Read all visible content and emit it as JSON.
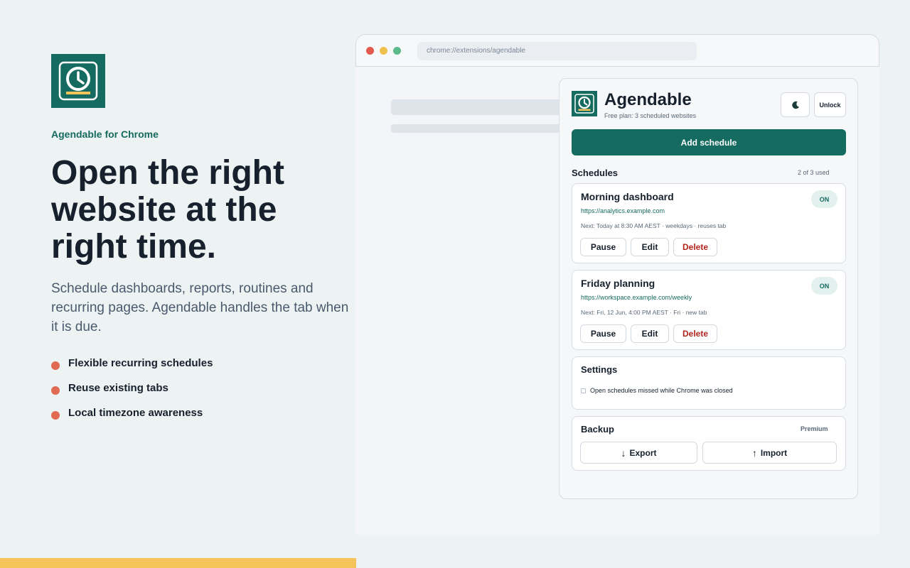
{
  "marketing": {
    "brand": "Agendable for Chrome",
    "headline": "Open the right website at the right time.",
    "subtext": "Schedule dashboards, reports, routines and recurring pages. Agendable handles the tab when it is due.",
    "features": [
      "Flexible recurring schedules",
      "Reuse existing tabs",
      "Local timezone awareness"
    ]
  },
  "browser": {
    "url": "chrome://extensions/agendable"
  },
  "popup": {
    "title": "Agendable",
    "plan": "Free plan: 3 scheduled websites",
    "theme_icon": "moon-icon",
    "unlock_label": "Unlock",
    "add_label": "Add schedule",
    "schedules_title": "Schedules",
    "schedules_used": "2 of 3 used",
    "schedules": [
      {
        "name": "Morning dashboard",
        "url": "https://analytics.example.com",
        "next": "Next: Today at 8:30 AM AEST · weekdays · reuses tab",
        "status": "ON",
        "pause": "Pause",
        "edit": "Edit",
        "delete": "Delete"
      },
      {
        "name": "Friday planning",
        "url": "https://workspace.example.com/weekly",
        "next": "Next: Fri, 12 Jun, 4:00 PM AEST · Fri · new tab",
        "status": "ON",
        "pause": "Pause",
        "edit": "Edit",
        "delete": "Delete"
      }
    ],
    "settings": {
      "title": "Settings",
      "option": "Open schedules missed while Chrome was closed",
      "option_checked": false
    },
    "backup": {
      "title": "Backup",
      "badge": "Premium",
      "export_arrow": "↓",
      "export_label": "Export",
      "import_arrow": "↑",
      "import_label": "Import"
    }
  },
  "colors": {
    "brand_green": "#156b5f",
    "accent_red": "#e06a52",
    "accent_yellow": "#f4c45b",
    "delete_red": "#b3261e"
  }
}
